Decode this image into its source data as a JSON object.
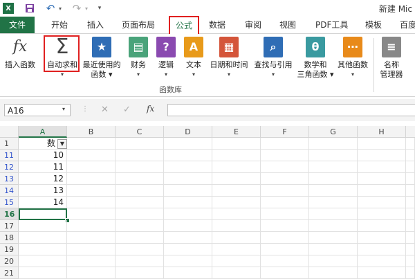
{
  "titlebar": {
    "logo": "X",
    "doc_title": "新建 Mic",
    "icons": [
      "excel-logo",
      "save-icon",
      "undo-icon",
      "undo-dropdown-icon",
      "redo-icon",
      "redo-dropdown-icon",
      "qat-customize-icon"
    ]
  },
  "tabs": [
    {
      "id": "file",
      "label": "文件"
    },
    {
      "id": "home",
      "label": "开始"
    },
    {
      "id": "insert",
      "label": "插入"
    },
    {
      "id": "layout",
      "label": "页面布局"
    },
    {
      "id": "formulas",
      "label": "公式"
    },
    {
      "id": "data",
      "label": "数据"
    },
    {
      "id": "review",
      "label": "审阅"
    },
    {
      "id": "view",
      "label": "视图"
    },
    {
      "id": "pdf",
      "label": "PDF工具"
    },
    {
      "id": "template",
      "label": "模板"
    },
    {
      "id": "baidu",
      "label": "百度"
    }
  ],
  "ribbon": {
    "group_label": "函数库",
    "buttons": [
      {
        "id": "insert-function",
        "line1": "插入函数",
        "line2": "",
        "icon": "fx",
        "color": "#444444"
      },
      {
        "id": "autosum",
        "line1": "自动求和",
        "line2": "▾",
        "icon": "Σ",
        "color": "#444444"
      },
      {
        "id": "recent",
        "line1": "最近使用的",
        "line2": "函数 ▾",
        "icon": "★",
        "color": "#2f6db5"
      },
      {
        "id": "financial",
        "line1": "财务",
        "line2": "▾",
        "icon": "▤",
        "color": "#4aa37a"
      },
      {
        "id": "logical",
        "line1": "逻辑",
        "line2": "▾",
        "icon": "?",
        "color": "#8a4ab0"
      },
      {
        "id": "text",
        "line1": "文本",
        "line2": "▾",
        "icon": "A",
        "color": "#e89a1a"
      },
      {
        "id": "datetime",
        "line1": "日期和时间",
        "line2": "▾",
        "icon": "▦",
        "color": "#d4553a"
      },
      {
        "id": "lookup",
        "line1": "查找与引用",
        "line2": "▾",
        "icon": "⌕",
        "color": "#2f6db5"
      },
      {
        "id": "math",
        "line1": "数学和",
        "line2": "三角函数 ▾",
        "icon": "θ",
        "color": "#3a9aa0"
      },
      {
        "id": "more",
        "line1": "其他函数",
        "line2": "▾",
        "icon": "⋯",
        "color": "#e88a1a"
      },
      {
        "id": "name-manager",
        "line1": "名称",
        "line2": "管理器",
        "icon": "≡",
        "color": "#888888"
      }
    ]
  },
  "formulabar": {
    "namebox": "A16",
    "cancel": "✕",
    "enter": "✓",
    "fx": "fx"
  },
  "grid": {
    "columns": [
      "A",
      "B",
      "C",
      "D",
      "E",
      "F",
      "G",
      "H"
    ],
    "rows": [
      {
        "num": "1",
        "a": "数",
        "filtered": false,
        "header": true
      },
      {
        "num": "11",
        "a": "10",
        "filtered": true
      },
      {
        "num": "12",
        "a": "11",
        "filtered": true
      },
      {
        "num": "13",
        "a": "12",
        "filtered": true
      },
      {
        "num": "14",
        "a": "13",
        "filtered": true
      },
      {
        "num": "15",
        "a": "14",
        "filtered": true
      },
      {
        "num": "16",
        "a": "",
        "filtered": false,
        "active": true
      },
      {
        "num": "17",
        "a": "",
        "filtered": false
      },
      {
        "num": "18",
        "a": "",
        "filtered": false
      },
      {
        "num": "19",
        "a": "",
        "filtered": false
      },
      {
        "num": "20",
        "a": "",
        "filtered": false
      },
      {
        "num": "21",
        "a": "",
        "filtered": false
      }
    ],
    "active_cell": "A16"
  },
  "colors": {
    "excel_green": "#217346",
    "highlight_red": "#e02020",
    "filtered_row_num": "#3355cc"
  }
}
